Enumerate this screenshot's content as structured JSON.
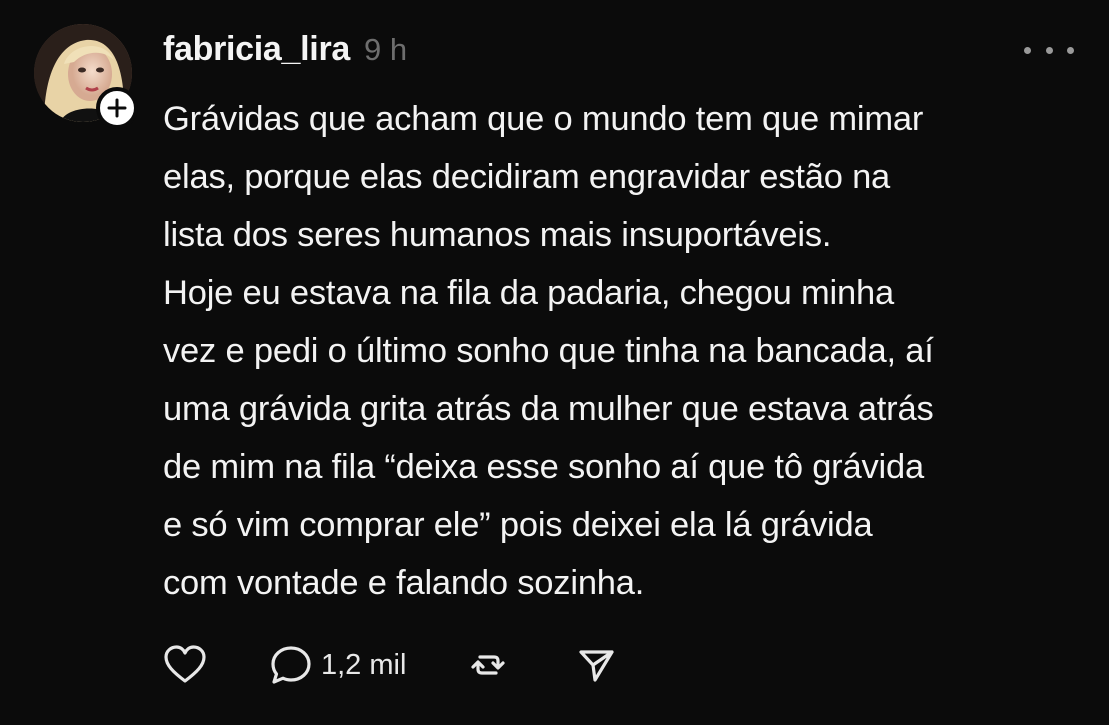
{
  "post": {
    "username": "fabricia_lira",
    "time": "9 h",
    "lines": [
      "Grávidas que acham que o mundo tem que mimar",
      "elas, porque elas decidiram engravidar estão na",
      "lista dos seres humanos mais insuportáveis.",
      "Hoje eu estava na fila da padaria, chegou minha",
      "vez e pedi o último sonho que tinha na bancada, aí",
      "uma grávida grita atrás da mulher que estava atrás",
      "de mim na fila “deixa esse sonho aí que tô grávida",
      "e só vim comprar ele” pois deixei ela lá grávida",
      "com vontade e falando sozinha."
    ],
    "reply_count": "1,2 mil"
  },
  "icons": {
    "avatar": "profile-photo",
    "follow": "plus-icon",
    "more": "more-dots-icon",
    "like": "heart-icon",
    "reply": "comment-bubble-icon",
    "repost": "repost-icon",
    "share": "send-icon"
  },
  "colors": {
    "background": "#0b0b0b",
    "text": "#f3f3f3",
    "muted": "#6e6e6e"
  }
}
